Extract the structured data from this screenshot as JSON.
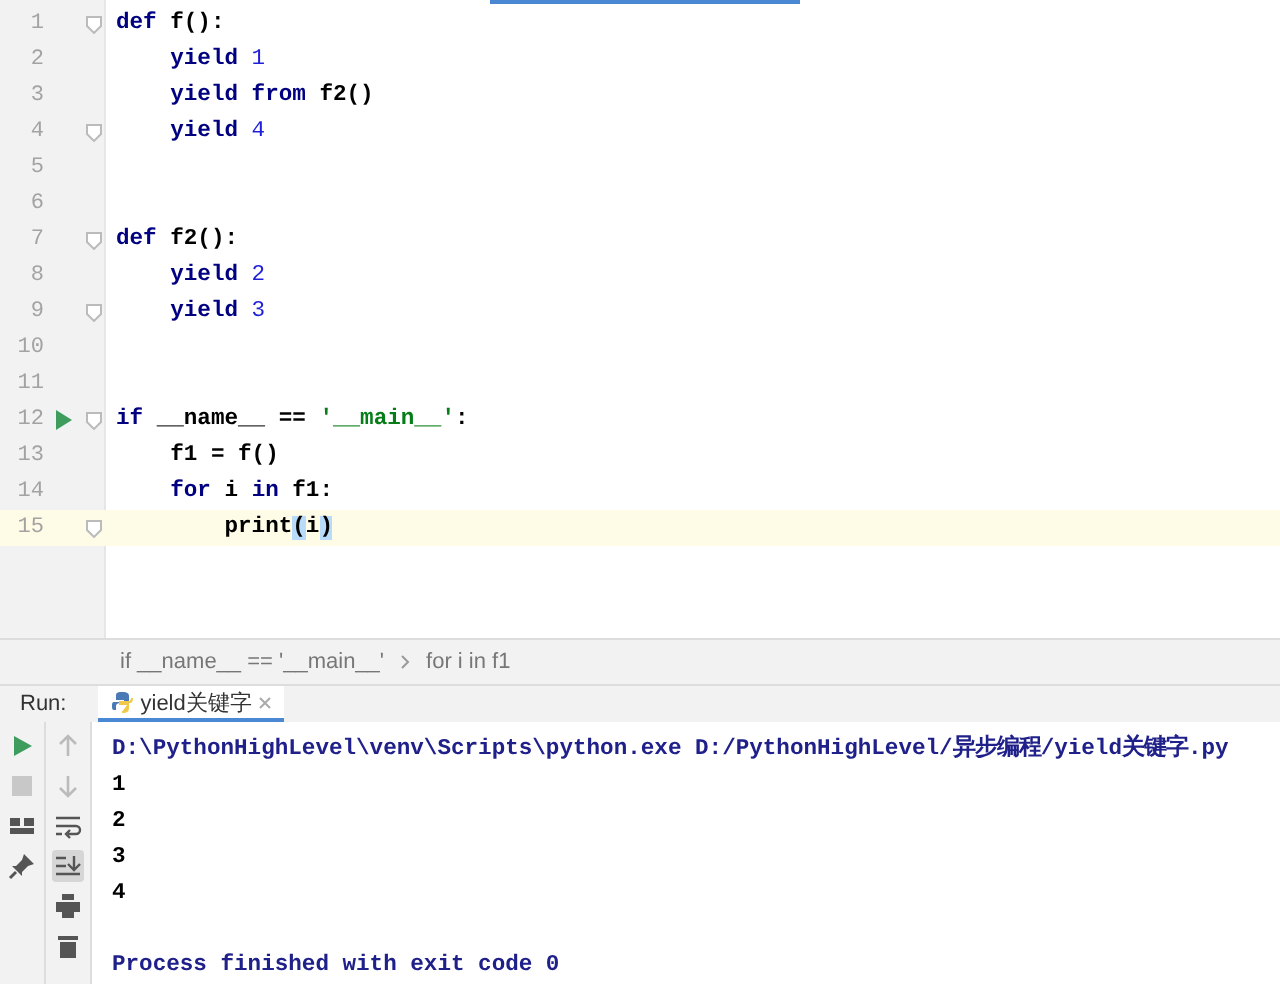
{
  "editor": {
    "lines": [
      {
        "number": "1",
        "fold": true,
        "run_marker": false,
        "current": false,
        "tokens": [
          {
            "kind": "kw",
            "text": "def"
          },
          {
            "kind": "plain",
            "text": " f():"
          }
        ]
      },
      {
        "number": "2",
        "fold": false,
        "run_marker": false,
        "current": false,
        "tokens": [
          {
            "kind": "kw",
            "text": "    yield"
          },
          {
            "kind": "num",
            "text": " 1"
          }
        ]
      },
      {
        "number": "3",
        "fold": false,
        "run_marker": false,
        "current": false,
        "tokens": [
          {
            "kind": "kw",
            "text": "    yield from"
          },
          {
            "kind": "plain",
            "text": " f2()"
          }
        ]
      },
      {
        "number": "4",
        "fold": true,
        "run_marker": false,
        "current": false,
        "tokens": [
          {
            "kind": "kw",
            "text": "    yield"
          },
          {
            "kind": "num",
            "text": " 4"
          }
        ]
      },
      {
        "number": "5",
        "fold": false,
        "run_marker": false,
        "current": false
      },
      {
        "number": "6",
        "fold": false,
        "run_marker": false,
        "current": false
      },
      {
        "number": "7",
        "fold": true,
        "run_marker": false,
        "current": false,
        "tokens": [
          {
            "kind": "kw",
            "text": "def"
          },
          {
            "kind": "plain",
            "text": " f2():"
          }
        ]
      },
      {
        "number": "8",
        "fold": false,
        "run_marker": false,
        "current": false,
        "tokens": [
          {
            "kind": "kw",
            "text": "    yield"
          },
          {
            "kind": "num",
            "text": " 2"
          }
        ]
      },
      {
        "number": "9",
        "fold": true,
        "run_marker": false,
        "current": false,
        "tokens": [
          {
            "kind": "kw",
            "text": "    yield"
          },
          {
            "kind": "num",
            "text": " 3"
          }
        ]
      },
      {
        "number": "10",
        "fold": false,
        "run_marker": false,
        "current": false
      },
      {
        "number": "11",
        "fold": false,
        "run_marker": false,
        "current": false
      },
      {
        "number": "12",
        "fold": true,
        "run_marker": true,
        "current": false,
        "tokens": [
          {
            "kind": "kw",
            "text": "if"
          },
          {
            "kind": "plain",
            "text": " __name__ == "
          },
          {
            "kind": "str",
            "text": "'__main__'"
          },
          {
            "kind": "plain",
            "text": ":"
          }
        ]
      },
      {
        "number": "13",
        "fold": false,
        "run_marker": false,
        "current": false,
        "tokens": [
          {
            "kind": "plain",
            "text": "    f1 = f()"
          }
        ]
      },
      {
        "number": "14",
        "fold": false,
        "run_marker": false,
        "current": false,
        "tokens": [
          {
            "kind": "kw",
            "text": "    for"
          },
          {
            "kind": "plain",
            "text": " i "
          },
          {
            "kind": "kw",
            "text": "in"
          },
          {
            "kind": "plain",
            "text": " f1:"
          }
        ]
      },
      {
        "number": "15",
        "fold": true,
        "run_marker": false,
        "current": true,
        "tokens": [
          {
            "kind": "plain",
            "text": "        print"
          },
          {
            "kind": "brace",
            "text": "("
          },
          {
            "kind": "plain",
            "text": "i"
          },
          {
            "kind": "brace",
            "text": ")"
          }
        ]
      }
    ]
  },
  "breadcrumbs": [
    "if __name__ == '__main__'",
    "for i in f1"
  ],
  "run_panel": {
    "label": "Run:",
    "tabs": [
      {
        "label": "yield关键字",
        "selected": true
      }
    ],
    "left_tools": [
      {
        "kind": "run"
      },
      {
        "kind": "stop"
      },
      {
        "kind": "layout"
      },
      {
        "kind": "pin"
      }
    ],
    "right_tools": [
      {
        "kind": "up",
        "on": false
      },
      {
        "kind": "down",
        "on": false
      },
      {
        "kind": "wrap",
        "on": false
      },
      {
        "kind": "end",
        "on": true
      },
      {
        "kind": "print",
        "on": false
      },
      {
        "kind": "trash",
        "on": false
      }
    ],
    "console": [
      {
        "kind": "command",
        "text": "D:\\PythonHighLevel\\venv\\Scripts\\python.exe D:/PythonHighLevel/异步编程/yield关键字.py"
      },
      {
        "kind": "output",
        "text": "1"
      },
      {
        "kind": "output",
        "text": "2"
      },
      {
        "kind": "output",
        "text": "3"
      },
      {
        "kind": "output",
        "text": "4"
      },
      {
        "kind": "blank"
      },
      {
        "kind": "status",
        "text": "Process finished with exit code 0"
      }
    ]
  }
}
